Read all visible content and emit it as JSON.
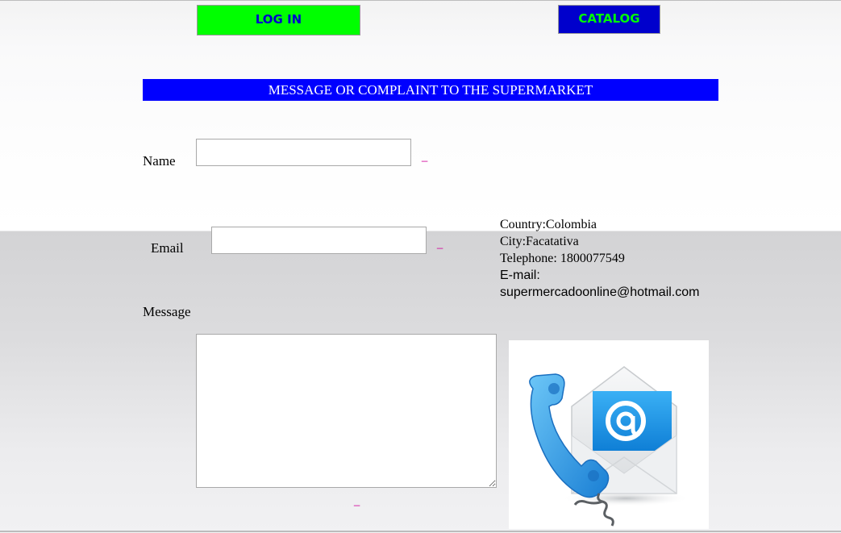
{
  "nav": {
    "login_label": "LOG IN",
    "catalog_label": "CATALOG"
  },
  "banner": {
    "title": "MESSAGE OR COMPLAINT TO THE SUPERMARKET"
  },
  "form": {
    "name_label": "Name",
    "name_value": "",
    "name_error": "_",
    "email_label": "Email",
    "email_value": "",
    "email_error": "_",
    "message_label": "Message",
    "message_value": "",
    "message_error": "_"
  },
  "contact": {
    "country": "Country:Colombia",
    "city": "City:Facatativa",
    "telephone": "Telephone: 1800077549",
    "email_prefix": "E-mail:",
    "email_address": "supermercadoonline@hotmail.com"
  },
  "image": {
    "icon_names": [
      "phone-icon",
      "email-envelope-icon"
    ],
    "colors": {
      "phone": "#2e8fe0",
      "envelope_screen": "#1a8ee8",
      "envelope_body": "#eef0f2"
    }
  },
  "colors": {
    "login_bg": "#00ff00",
    "login_text": "#0000cc",
    "catalog_bg": "#0000cc",
    "catalog_text": "#00ff00",
    "banner_bg": "#0000ff",
    "error_text": "#d0009a"
  }
}
